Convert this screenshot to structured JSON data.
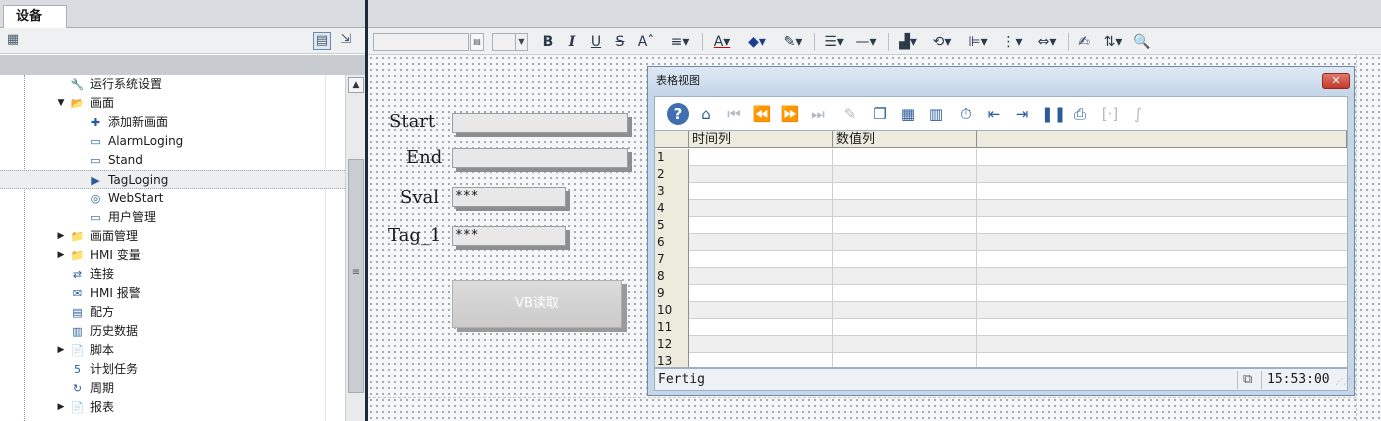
{
  "left_panel": {
    "tab_label": "设备",
    "tree": [
      {
        "label": "运行系统设置",
        "icon": "wrench-icon",
        "glyph": "🔧",
        "arrow": "",
        "indent": 1
      },
      {
        "label": "画面",
        "icon": "folder-open-icon",
        "glyph": "📂",
        "arrow": "▼",
        "indent": 1
      },
      {
        "label": "添加新画面",
        "icon": "add-screen-icon",
        "glyph": "✚",
        "arrow": "",
        "indent": 2
      },
      {
        "label": "AlarmLoging",
        "icon": "screen-icon",
        "glyph": "▭",
        "arrow": "",
        "indent": 2
      },
      {
        "label": "Stand",
        "icon": "screen-icon",
        "glyph": "▭",
        "arrow": "",
        "indent": 2
      },
      {
        "label": "TagLoging",
        "icon": "screen-start-icon",
        "glyph": "▶",
        "arrow": "",
        "indent": 2,
        "selected": true
      },
      {
        "label": "WebStart",
        "icon": "screen-web-icon",
        "glyph": "◎",
        "arrow": "",
        "indent": 2
      },
      {
        "label": "用户管理",
        "icon": "screen-icon",
        "glyph": "▭",
        "arrow": "",
        "indent": 2
      },
      {
        "label": "画面管理",
        "icon": "folder-screens-icon",
        "glyph": "📁",
        "arrow": "▶",
        "indent": 1
      },
      {
        "label": "HMI 变量",
        "icon": "folder-tags-icon",
        "glyph": "📁",
        "arrow": "▶",
        "indent": 1
      },
      {
        "label": "连接",
        "icon": "connection-icon",
        "glyph": "⇄",
        "arrow": "",
        "indent": 1
      },
      {
        "label": "HMI 报警",
        "icon": "alarm-envelope-icon",
        "glyph": "✉",
        "arrow": "",
        "indent": 1
      },
      {
        "label": "配方",
        "icon": "recipe-icon",
        "glyph": "▤",
        "arrow": "",
        "indent": 1
      },
      {
        "label": "历史数据",
        "icon": "historical-data-icon",
        "glyph": "▥",
        "arrow": "",
        "indent": 1
      },
      {
        "label": "脚本",
        "icon": "script-icon",
        "glyph": "📄",
        "arrow": "▶",
        "indent": 1
      },
      {
        "label": "计划任务",
        "icon": "scheduler-icon",
        "glyph": "5",
        "arrow": "",
        "indent": 1
      },
      {
        "label": "周期",
        "icon": "cycle-icon",
        "glyph": "↻",
        "arrow": "",
        "indent": 1
      },
      {
        "label": "报表",
        "icon": "report-icon",
        "glyph": "📄",
        "arrow": "▶",
        "indent": 1
      }
    ]
  },
  "screen": {
    "labels": {
      "start": "Start",
      "end": "End",
      "sval": "Sval",
      "tag1": "Tag_1"
    },
    "fields": {
      "start_value": "",
      "end_value": "",
      "sval_value": "***",
      "tag1_value": "***"
    },
    "button_label": "VB读取"
  },
  "table_view": {
    "title": "表格视图",
    "close_glyph": "✕",
    "columns": [
      "时间列",
      "数值列"
    ],
    "rows": [
      "1",
      "2",
      "3",
      "4",
      "5",
      "6",
      "7",
      "8",
      "9",
      "10",
      "11",
      "12",
      "13"
    ],
    "status_text": "Fertig",
    "time": "15:53:00"
  }
}
